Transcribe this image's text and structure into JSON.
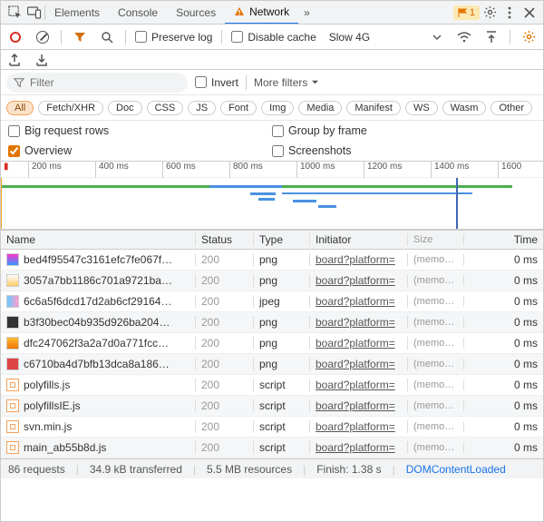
{
  "topbar": {
    "tabs": [
      "Elements",
      "Console",
      "Sources",
      "Network"
    ],
    "active_tab": 3,
    "overflow_label": "»",
    "warning_count": "1"
  },
  "toolbar": {
    "preserve_log": "Preserve log",
    "disable_cache": "Disable cache",
    "throttle": "Slow 4G"
  },
  "filterbar": {
    "filter_placeholder": "Filter",
    "invert": "Invert",
    "more_filters": "More filters"
  },
  "chips": [
    "All",
    "Fetch/XHR",
    "Doc",
    "CSS",
    "JS",
    "Font",
    "Img",
    "Media",
    "Manifest",
    "WS",
    "Wasm",
    "Other"
  ],
  "chips_active": 0,
  "options": {
    "big_rows": "Big request rows",
    "group_frame": "Group by frame",
    "overview": "Overview",
    "screenshots": "Screenshots",
    "overview_checked": true
  },
  "timeline": {
    "ticks": [
      "200 ms",
      "400 ms",
      "600 ms",
      "800 ms",
      "1000 ms",
      "1200 ms",
      "1400 ms",
      "1600"
    ]
  },
  "columns": {
    "name": "Name",
    "status": "Status",
    "type": "Type",
    "initiator": "Initiator",
    "size": "Size",
    "time": "Time"
  },
  "rows": [
    {
      "ico": "png1",
      "name": "bed4f95547c3161efc7fe067f…",
      "status": "200",
      "type": "png",
      "initiator": "board?platform=",
      "size": "(memo…",
      "time": "0 ms"
    },
    {
      "ico": "png2",
      "name": "3057a7bb1186c701a9721ba…",
      "status": "200",
      "type": "png",
      "initiator": "board?platform=",
      "size": "(memo…",
      "time": "0 ms"
    },
    {
      "ico": "jpeg",
      "name": "6c6a5f6dcd17d2ab6cf29164…",
      "status": "200",
      "type": "jpeg",
      "initiator": "board?platform=",
      "size": "(memo…",
      "time": "0 ms"
    },
    {
      "ico": "png3",
      "name": "b3f30bec04b935d926ba204…",
      "status": "200",
      "type": "png",
      "initiator": "board?platform=",
      "size": "(memo…",
      "time": "0 ms"
    },
    {
      "ico": "png4",
      "name": "dfc247062f3a2a7d0a771fcc…",
      "status": "200",
      "type": "png",
      "initiator": "board?platform=",
      "size": "(memo…",
      "time": "0 ms"
    },
    {
      "ico": "png5",
      "name": "c6710ba4d7bfb13dca8a186…",
      "status": "200",
      "type": "png",
      "initiator": "board?platform=",
      "size": "(memo…",
      "time": "0 ms"
    },
    {
      "ico": "js",
      "name": "polyfills.js",
      "status": "200",
      "type": "script",
      "initiator": "board?platform=",
      "size": "(memo…",
      "time": "0 ms"
    },
    {
      "ico": "js",
      "name": "polyfillsIE.js",
      "status": "200",
      "type": "script",
      "initiator": "board?platform=",
      "size": "(memo…",
      "time": "0 ms"
    },
    {
      "ico": "js",
      "name": "svn.min.js",
      "status": "200",
      "type": "script",
      "initiator": "board?platform=",
      "size": "(memo…",
      "time": "0 ms"
    },
    {
      "ico": "js",
      "name": "main_ab55b8d.js",
      "status": "200",
      "type": "script",
      "initiator": "board?platform=",
      "size": "(memo…",
      "time": "0 ms"
    }
  ],
  "status": {
    "requests": "86 requests",
    "transferred": "34.9 kB transferred",
    "resources": "5.5 MB resources",
    "finish": "Finish: 1.38 s",
    "domloaded": "DOMContentLoaded"
  }
}
